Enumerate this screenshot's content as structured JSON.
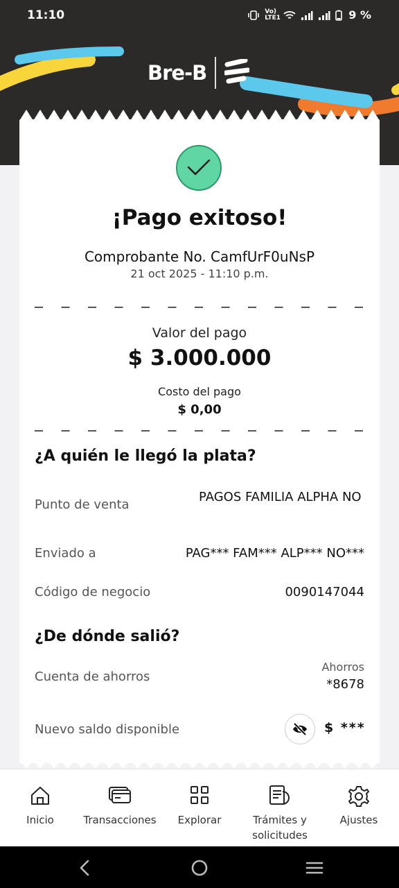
{
  "status_bar": {
    "time": "11:10",
    "network_label": "Vo) LTE1",
    "battery_percent": "9 %"
  },
  "brand": {
    "name": "Bre-B",
    "colors": {
      "yellow": "#f7d53b",
      "blue": "#5bc8ec",
      "orange": "#f07a2e",
      "dark": "#2b2a29"
    }
  },
  "receipt": {
    "status_icon": "check-icon",
    "title": "¡Pago exitoso!",
    "comprobante": "Comprobante No. CamfUrF0uNsP",
    "fecha": "21 oct 2025 - 11:10 p.m.",
    "valor_label": "Valor del pago",
    "valor_amount": "$ 3.000.000",
    "costo_label": "Costo del pago",
    "costo_amount": "$ 0,00",
    "destino": {
      "title": "¿A quién le llegó la plata?",
      "rows": [
        {
          "label": "Punto de venta",
          "value": "PAGOS FAMILIA ALPHA NO"
        },
        {
          "label": "Enviado a",
          "value": "PAG*** FAM*** ALP*** NO***"
        },
        {
          "label": "Código de negocio",
          "value": "0090147044"
        }
      ]
    },
    "origen": {
      "title": "¿De dónde salió?",
      "cuenta_label": "Cuenta de ahorros",
      "cuenta_tipo": "Ahorros",
      "cuenta_numero": "*8678",
      "saldo_label": "Nuevo saldo disponible",
      "saldo_value": "$ ***",
      "saldo_toggle_icon": "eye-off-icon"
    }
  },
  "bottom_nav": {
    "items": [
      {
        "label": "Inicio",
        "icon": "home-icon"
      },
      {
        "label": "Transacciones",
        "icon": "cards-icon"
      },
      {
        "label": "Explorar",
        "icon": "grid-icon"
      },
      {
        "label": "Trámites y solicitudes",
        "icon": "documents-icon"
      },
      {
        "label": "Ajustes",
        "icon": "gear-icon"
      }
    ]
  },
  "system_nav": {
    "icons": [
      "back-icon",
      "home-circle-icon",
      "recents-icon"
    ]
  }
}
